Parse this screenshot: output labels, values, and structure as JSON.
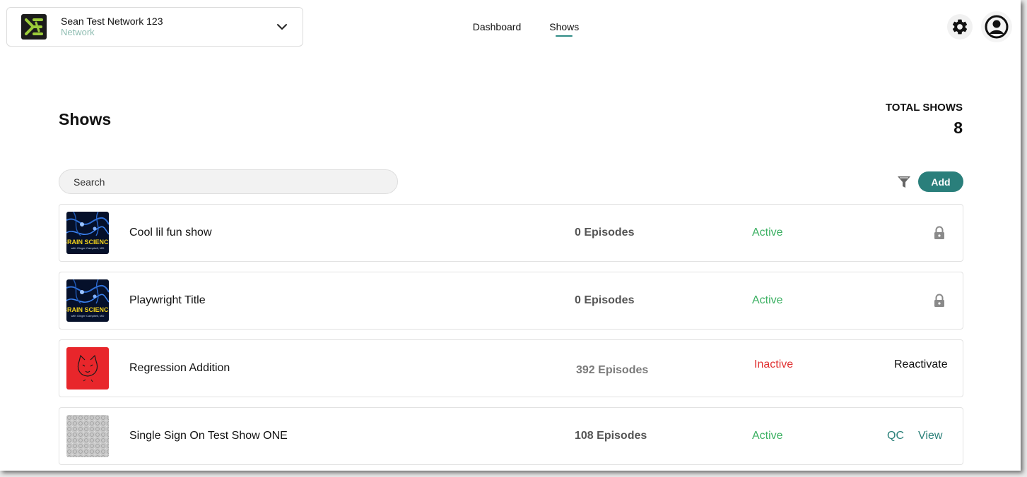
{
  "header": {
    "network_name": "Sean Test Network 123",
    "network_type": "Network",
    "nav": [
      {
        "label": "Dashboard",
        "active": false
      },
      {
        "label": "Shows",
        "active": true
      }
    ],
    "accent_color": "#2e8b85"
  },
  "page": {
    "title": "Shows",
    "total_label": "TOTAL SHOWS",
    "total_value": "8"
  },
  "toolbar": {
    "search_placeholder": "Search",
    "filter_icon": "filter-icon",
    "add_label": "Add",
    "add_color": "#2a7f7b"
  },
  "shows": [
    {
      "name": "Cool lil fun show",
      "episodes": "0 Episodes",
      "status": "Active",
      "thumb_text": "BRAIN SCIENCE",
      "thumb_subtext": "with Ginger Campbell, MD",
      "action": "lock-icon"
    },
    {
      "name": "Playwright Title",
      "episodes": "0 Episodes",
      "status": "Active",
      "thumb_text": "BRAIN SCIENCE",
      "thumb_subtext": "with Ginger Campbell, MD",
      "action": "lock-icon"
    },
    {
      "name": "Regression Addition",
      "episodes": "392 Episodes",
      "status": "Inactive",
      "action_label": "Reactivate"
    },
    {
      "name": "Single Sign On Test Show ONE",
      "episodes": "108 Episodes",
      "status": "Active",
      "qc_label": "QC",
      "view_label": "View"
    }
  ],
  "colors": {
    "active": "#3bb062",
    "inactive": "#e03131",
    "link": "#2a8079"
  }
}
